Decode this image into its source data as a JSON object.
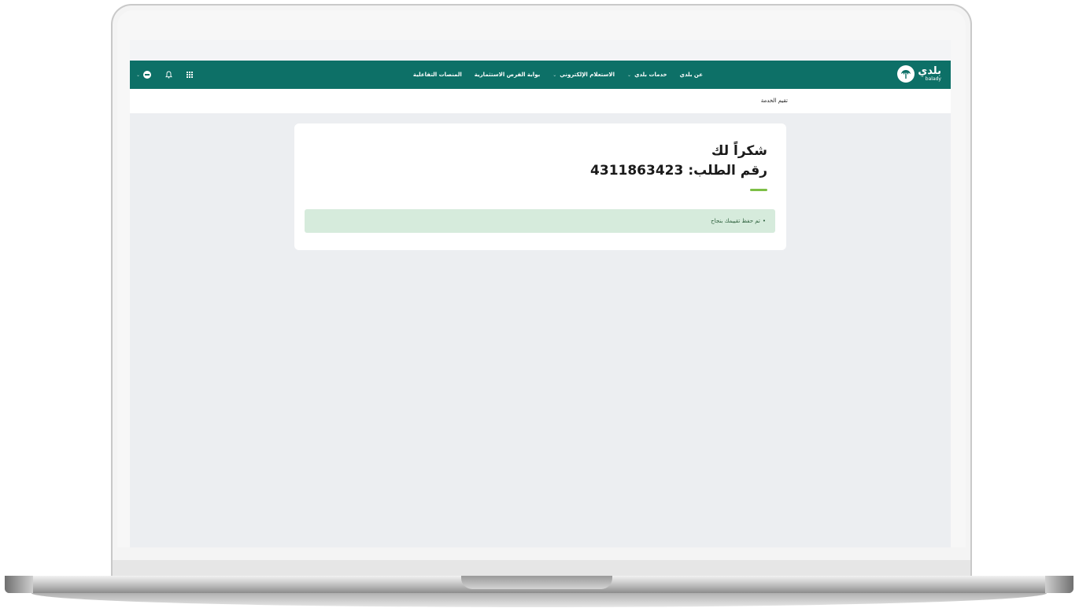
{
  "navbar": {
    "logo": {
      "arabic": "بلدي",
      "latin": "balady"
    },
    "links": [
      {
        "label": "عن بلدي",
        "dropdown": false
      },
      {
        "label": "خدمات بلدي",
        "dropdown": true
      },
      {
        "label": "الاستعلام الإلكتروني",
        "dropdown": true
      },
      {
        "label": "بوابة الفرص الاستثمارية",
        "dropdown": false
      },
      {
        "label": "المنصات التفاعلية",
        "dropdown": false
      }
    ],
    "icons": [
      "apps-grid-icon",
      "bell-icon",
      "globe-icon",
      "chevron-down-icon"
    ]
  },
  "breadcrumb": {
    "current": "تقيم الخدمة"
  },
  "card": {
    "title": "شكراً لك",
    "order_label": "رقم الطلب:",
    "order_number": "4311863423",
    "alert_message": "تم حفظ تقييمك بنجاح"
  },
  "colors": {
    "navbar": "#0d7067",
    "accent": "#7dbf46",
    "alert_bg": "#d6ebdc",
    "page_bg": "#eceef1"
  }
}
